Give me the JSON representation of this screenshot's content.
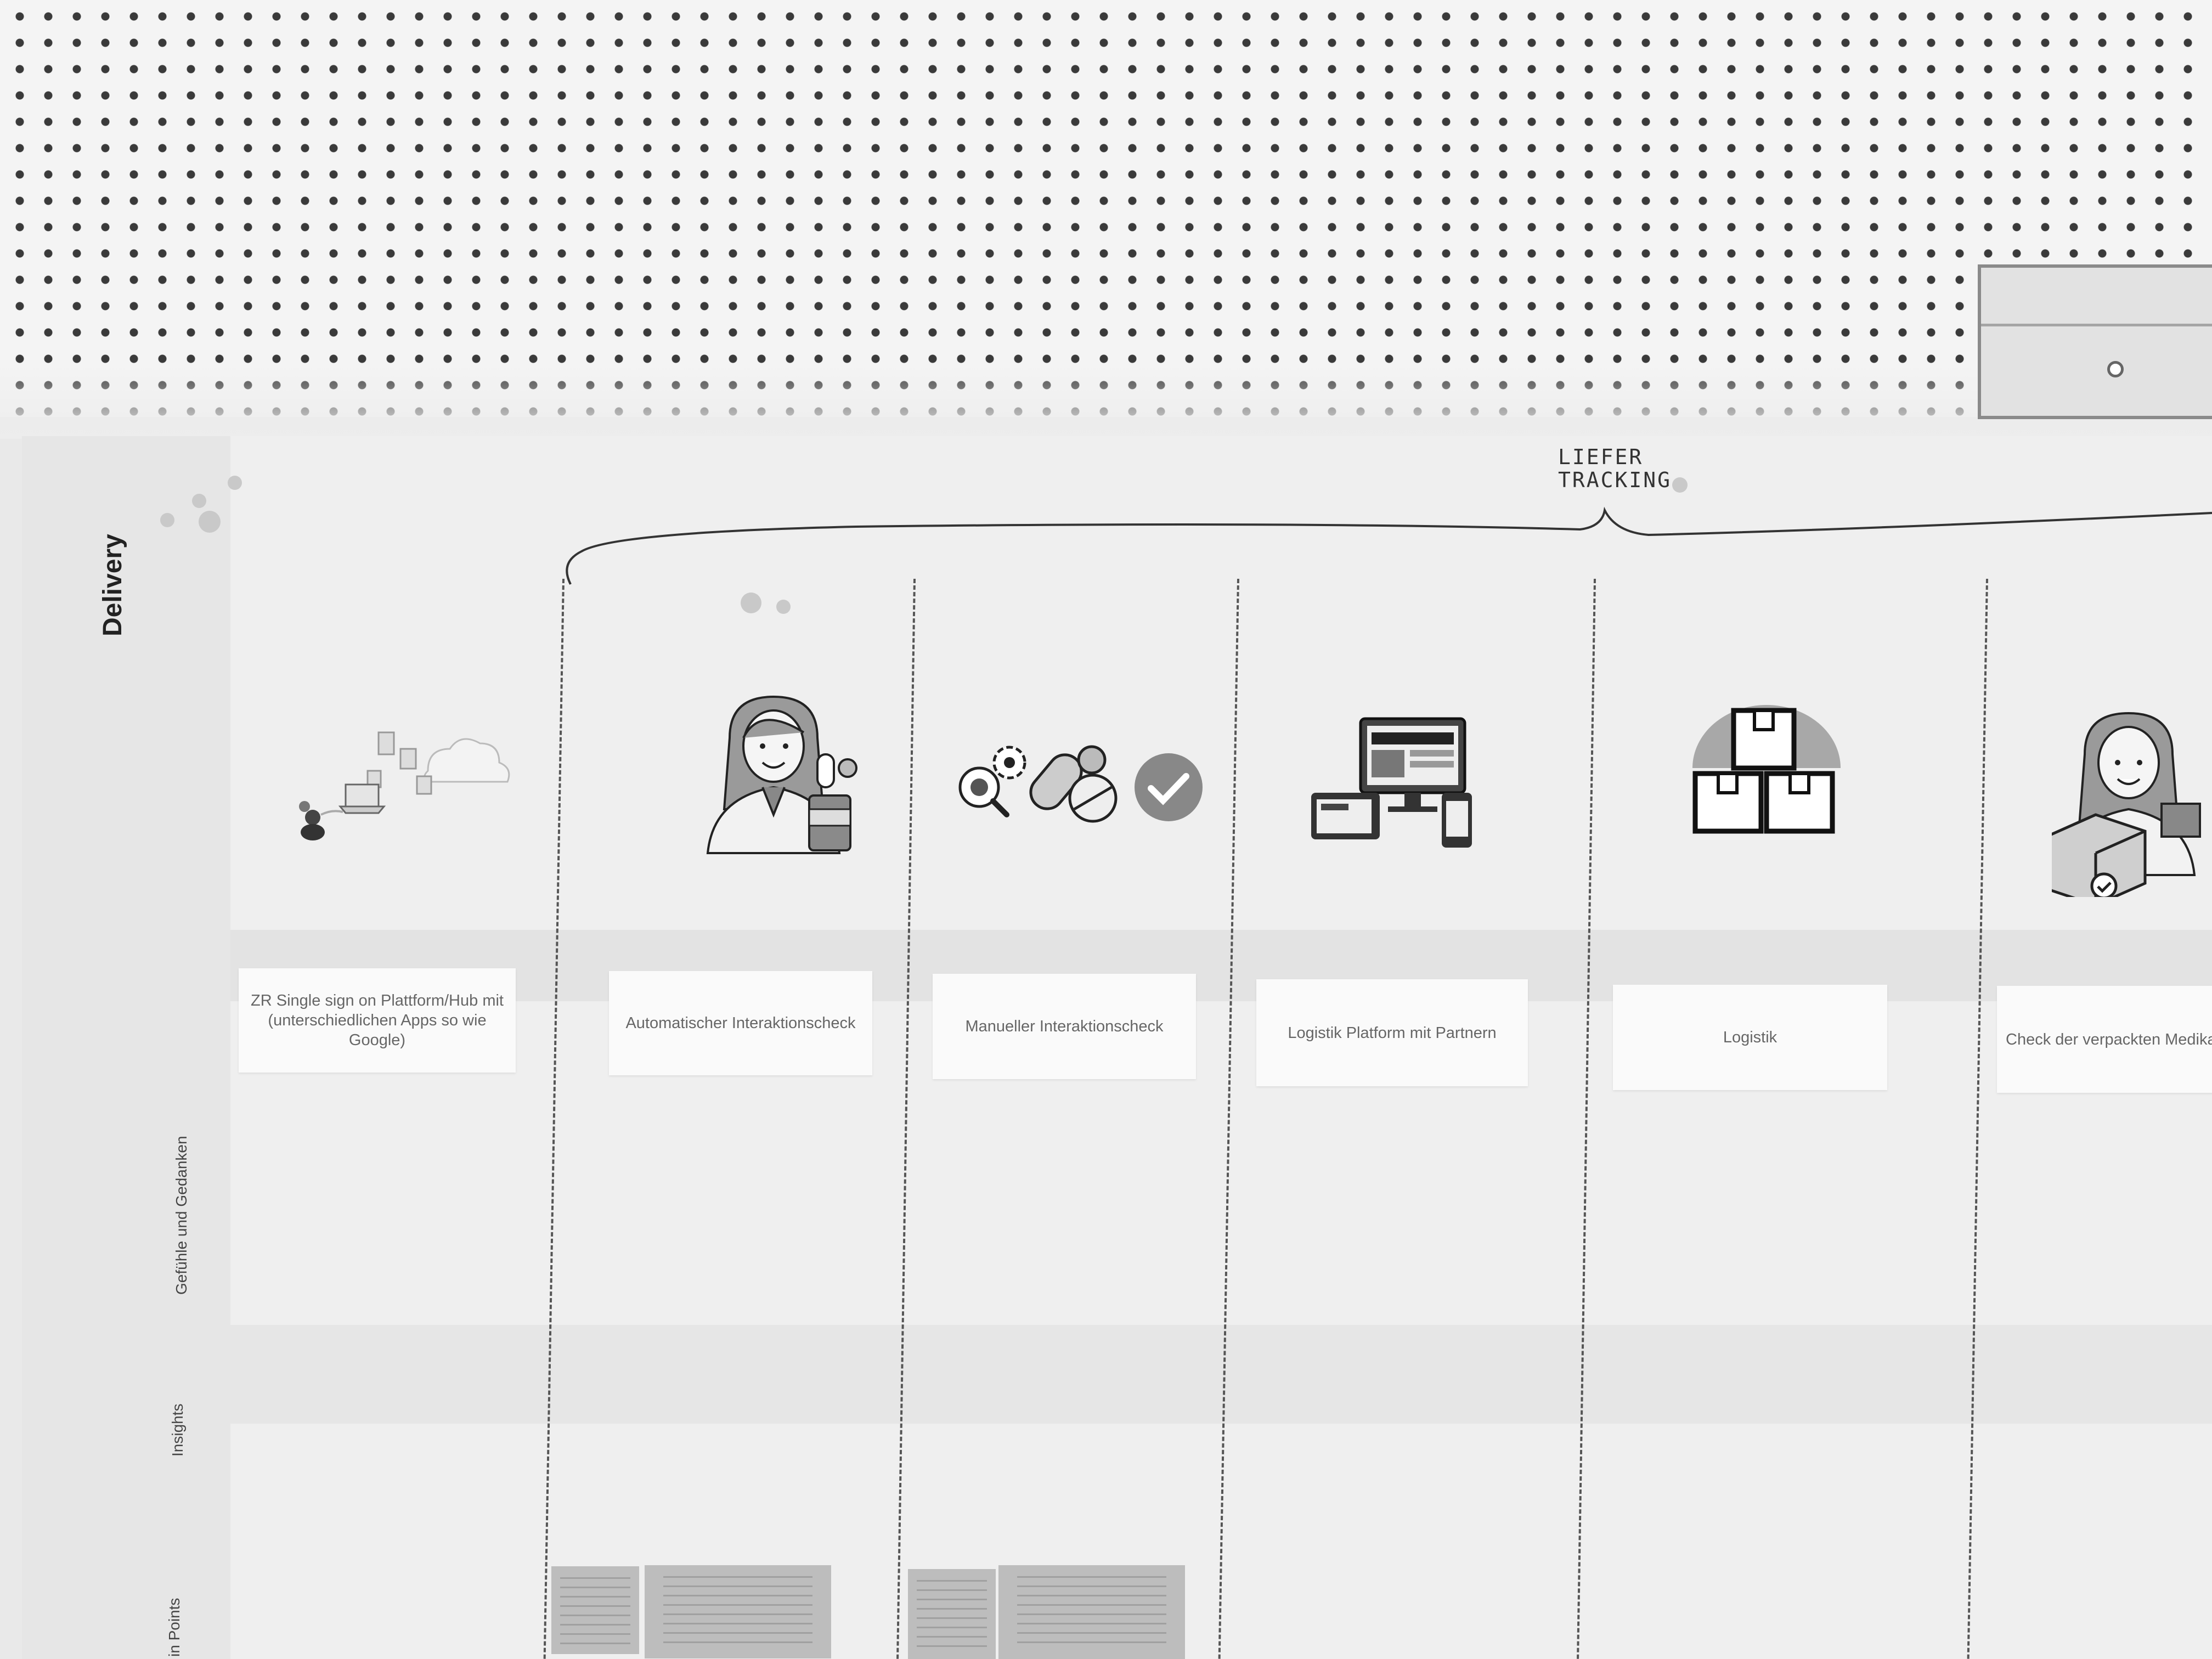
{
  "annotation": {
    "line1": "LIEFER",
    "line2": "TRACKING"
  },
  "board": {
    "title": "Delivery",
    "lanes": [
      "Gefühle und Gedanken",
      "Insights",
      "in Points"
    ]
  },
  "steps": [
    {
      "icon": "cloud-sync-icon",
      "label": "ZR Single sign on Plattform/Hub mit (unterschiedlichen Apps so wie Google)"
    },
    {
      "icon": "pharmacist-icon",
      "label": "Automatischer Interaktionscheck"
    },
    {
      "icon": "pills-check-icon",
      "label": "Manueller Interaktionscheck"
    },
    {
      "icon": "devices-icon",
      "label": "Logistik Platform mit Partnern"
    },
    {
      "icon": "boxes-icon",
      "label": "Logistik"
    },
    {
      "icon": "pharmacist-package-icon",
      "label": "Check der verpackten Medika"
    }
  ]
}
